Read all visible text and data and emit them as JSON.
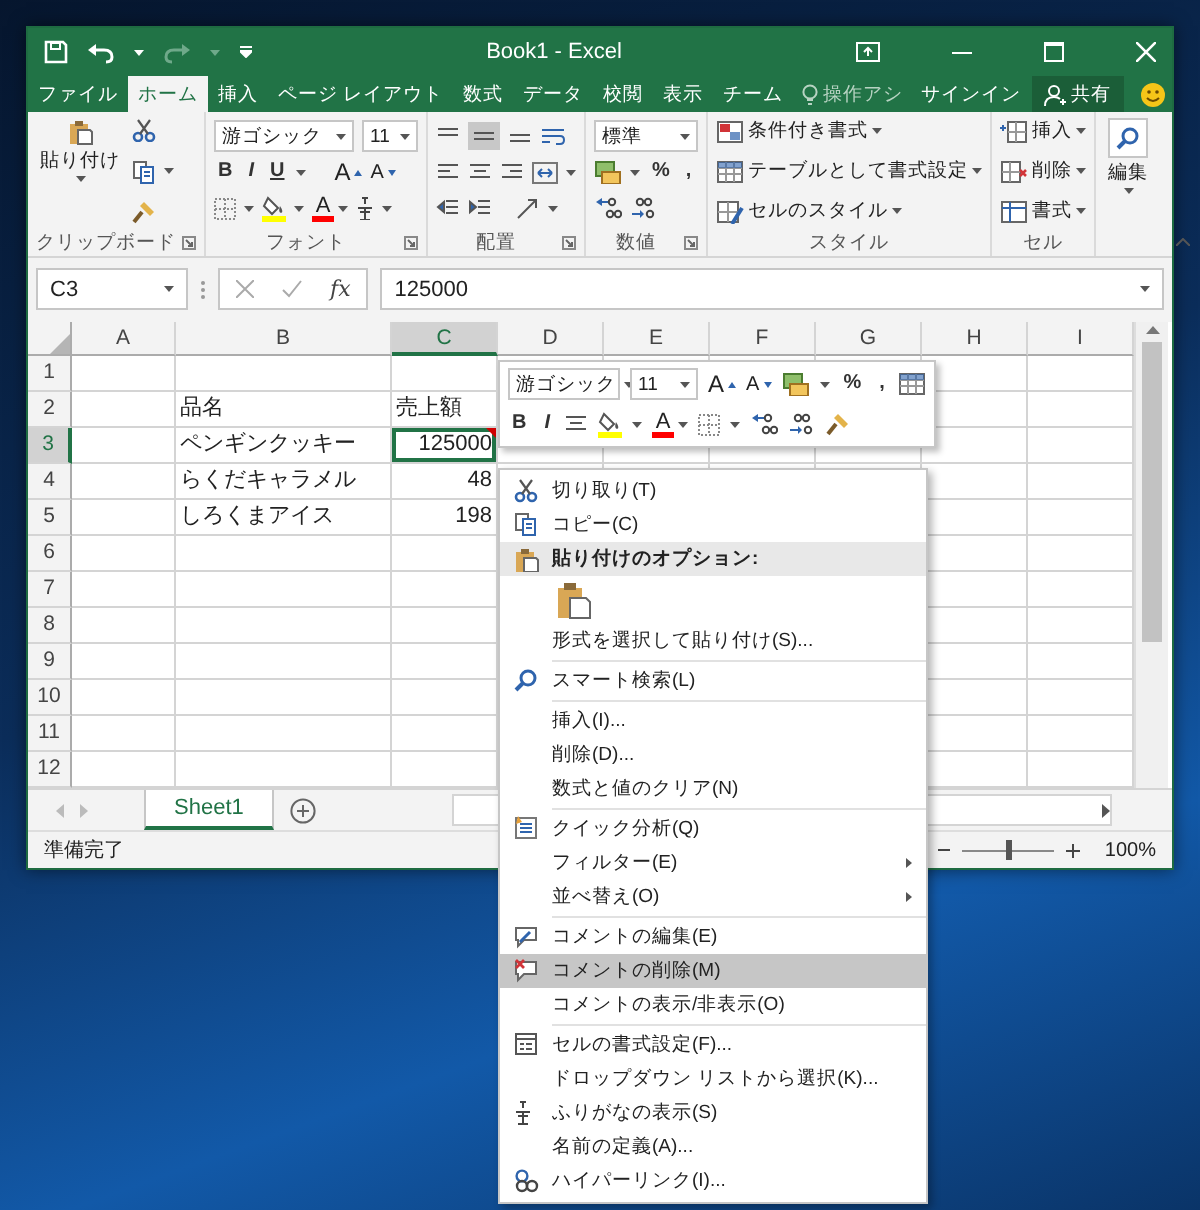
{
  "window": {
    "title": "Book1 - Excel"
  },
  "tabs": [
    {
      "label": "ファイル",
      "selected": false
    },
    {
      "label": "ホーム",
      "selected": true
    },
    {
      "label": "挿入",
      "selected": false
    },
    {
      "label": "ページ レイアウト",
      "selected": false
    },
    {
      "label": "数式",
      "selected": false
    },
    {
      "label": "データ",
      "selected": false
    },
    {
      "label": "校閲",
      "selected": false
    },
    {
      "label": "表示",
      "selected": false
    },
    {
      "label": "チーム",
      "selected": false
    }
  ],
  "tell_me": {
    "placeholder": "操作アシ"
  },
  "sign_in": "サインイン",
  "share": "共有",
  "ribbon": {
    "clipboard": {
      "label": "クリップボード",
      "paste": "貼り付け"
    },
    "font": {
      "label": "フォント",
      "font_name": "游ゴシック",
      "font_size": "11",
      "bold": "B",
      "italic": "I",
      "underline": "U",
      "grow": "A",
      "shrink": "A",
      "text_color_letter": "A"
    },
    "alignment": {
      "label": "配置",
      "middle_align": true
    },
    "number": {
      "label": "数値",
      "format": "標準",
      "percent": "%",
      "comma": ","
    },
    "styles": {
      "label": "スタイル",
      "buttons": [
        "条件付き書式",
        "テーブルとして書式設定",
        "セルのスタイル"
      ]
    },
    "cells": {
      "label": "セル",
      "buttons": [
        "挿入",
        "削除",
        "書式"
      ]
    },
    "editing": {
      "label": "編集"
    }
  },
  "name_box": "C3",
  "fx": "fx",
  "formula": "125000",
  "grid": {
    "columns": [
      {
        "label": "A",
        "selected": false
      },
      {
        "label": "B",
        "selected": false
      },
      {
        "label": "C",
        "selected": true
      },
      {
        "label": "D",
        "selected": false
      },
      {
        "label": "E",
        "selected": false
      },
      {
        "label": "F",
        "selected": false
      },
      {
        "label": "G",
        "selected": false
      },
      {
        "label": "H",
        "selected": false
      },
      {
        "label": "I",
        "selected": false
      }
    ],
    "rows": [
      {
        "label": "1",
        "selected": false
      },
      {
        "label": "2",
        "selected": false,
        "b": {
          "text": "品名",
          "kind": "text",
          "active": false,
          "comment": false
        },
        "c": {
          "text": "売上額",
          "kind": "text",
          "active": false,
          "comment": false
        }
      },
      {
        "label": "3",
        "selected": true,
        "b": {
          "text": "ペンギンクッキー",
          "kind": "text",
          "active": false,
          "comment": false
        },
        "c": {
          "text": "125000",
          "kind": "number",
          "active": true,
          "comment": true
        }
      },
      {
        "label": "4",
        "selected": false,
        "b": {
          "text": "らくだキャラメル",
          "kind": "text",
          "active": false,
          "comment": false
        },
        "c": {
          "text": "48",
          "kind": "number",
          "active": false,
          "comment": false
        }
      },
      {
        "label": "5",
        "selected": false,
        "b": {
          "text": "しろくまアイス",
          "kind": "text",
          "active": false,
          "comment": false
        },
        "c": {
          "text": "198",
          "kind": "number",
          "active": false,
          "comment": false
        }
      },
      {
        "label": "6",
        "selected": false
      },
      {
        "label": "7",
        "selected": false
      },
      {
        "label": "8",
        "selected": false
      },
      {
        "label": "9",
        "selected": false
      },
      {
        "label": "10",
        "selected": false
      },
      {
        "label": "11",
        "selected": false
      },
      {
        "label": "12",
        "selected": false
      }
    ]
  },
  "sheet_tabs": [
    {
      "label": "Sheet1",
      "selected": true
    }
  ],
  "status_bar": {
    "text": "準備完了",
    "zoom": "100%",
    "level": 0.5
  },
  "mini_toolbar": {
    "font_name": "游ゴシック",
    "font_size": "11",
    "grow": "A",
    "shrink": "A",
    "percent": "%",
    "comma": ",",
    "bold": "B",
    "italic": "I",
    "text_color_letter": "A"
  },
  "context_menu": [
    {
      "kind": "item",
      "label": "切り取り(T)",
      "selected": false,
      "submenu": false
    },
    {
      "kind": "item",
      "label": "コピー(C)",
      "selected": false,
      "submenu": false
    },
    {
      "kind": "header",
      "label": "貼り付けのオプション:"
    },
    {
      "kind": "paste-options"
    },
    {
      "kind": "item",
      "label": "形式を選択して貼り付け(S)...",
      "selected": false,
      "submenu": false
    },
    {
      "kind": "separator"
    },
    {
      "kind": "item",
      "label": "スマート検索(L)",
      "selected": false,
      "submenu": false
    },
    {
      "kind": "separator"
    },
    {
      "kind": "item",
      "label": "挿入(I)...",
      "selected": false,
      "submenu": false
    },
    {
      "kind": "item",
      "label": "削除(D)...",
      "selected": false,
      "submenu": false
    },
    {
      "kind": "item",
      "label": "数式と値のクリア(N)",
      "selected": false,
      "submenu": false
    },
    {
      "kind": "separator"
    },
    {
      "kind": "item",
      "label": "クイック分析(Q)",
      "selected": false,
      "submenu": false
    },
    {
      "kind": "item",
      "label": "フィルター(E)",
      "selected": false,
      "submenu": true
    },
    {
      "kind": "item",
      "label": "並べ替え(O)",
      "selected": false,
      "submenu": true
    },
    {
      "kind": "separator"
    },
    {
      "kind": "item",
      "label": "コメントの編集(E)",
      "selected": false,
      "submenu": false
    },
    {
      "kind": "item",
      "label": "コメントの削除(M)",
      "selected": true,
      "submenu": false
    },
    {
      "kind": "item",
      "label": "コメントの表示/非表示(O)",
      "selected": false,
      "submenu": false
    },
    {
      "kind": "separator"
    },
    {
      "kind": "item",
      "label": "セルの書式設定(F)...",
      "selected": false,
      "submenu": false
    },
    {
      "kind": "item",
      "label": "ドロップダウン リストから選択(K)...",
      "selected": false,
      "submenu": false
    },
    {
      "kind": "item",
      "label": "ふりがなの表示(S)",
      "selected": false,
      "submenu": false
    },
    {
      "kind": "item",
      "label": "名前の定義(A)...",
      "selected": false,
      "submenu": false
    },
    {
      "kind": "item",
      "label": "ハイパーリンク(I)...",
      "selected": false,
      "submenu": false
    }
  ]
}
